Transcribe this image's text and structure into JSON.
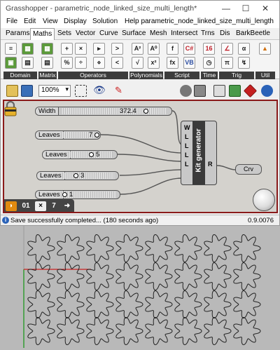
{
  "window": {
    "title": "Grasshopper - parametric_node_linked_size_multi_length*",
    "filename": "parametric_node_linked_size_multi_length",
    "controls": {
      "minimize": "—",
      "maximize": "☐",
      "close": "✕"
    }
  },
  "menu": [
    "File",
    "Edit",
    "View",
    "Display",
    "Solution",
    "Help"
  ],
  "tabs": [
    "Params",
    "Maths",
    "Sets",
    "Vector",
    "Curve",
    "Surface",
    "Mesh",
    "Intersect",
    "Trns",
    "Dis",
    "BarkBeetle"
  ],
  "active_tab": "Maths",
  "ribbon": {
    "groups": [
      "Domain",
      "Matrix",
      "Operators",
      "Polynomials",
      "Script",
      "Time",
      "Trig",
      "Util"
    ],
    "domain_icons": [
      "≡",
      "▦",
      "▣",
      "▤"
    ],
    "operator_icons": [
      "+",
      "×",
      "▸",
      "%",
      "○",
      "⋄",
      "=",
      "−",
      "÷",
      "|x|"
    ],
    "polynomial_icons": [
      "A²",
      "√",
      "x²",
      "A⁰"
    ],
    "script_icons": [
      "f",
      "C#",
      "fx",
      "VB"
    ],
    "time_icon": "16",
    "trig_icons": [
      "∠",
      "α",
      "π",
      "↯"
    ]
  },
  "toolbar": {
    "zoom": "100%"
  },
  "canvas": {
    "sliders": [
      {
        "label": "Width",
        "value": "372.4"
      },
      {
        "label": "Leaves",
        "value": "7"
      },
      {
        "label": "Leaves",
        "value": "5"
      },
      {
        "label": "Leaves",
        "value": "3"
      },
      {
        "label": "Leaves",
        "value": "1"
      }
    ],
    "component": {
      "name": "Kit generator",
      "inputs": [
        "W",
        "L",
        "L",
        "L",
        "L"
      ],
      "output": "R"
    },
    "output_param": "Crv",
    "bottom_bar": [
      "0",
      "1",
      "×",
      "7",
      "➜"
    ]
  },
  "status": {
    "message": "Save successfully completed... (180 seconds ago)",
    "version": "0.9.0076"
  },
  "colors": {
    "canvas_border": "#8a1a1a",
    "canvas_bg": "#d4d2cd",
    "viewport_bg": "#b9b9b9"
  }
}
